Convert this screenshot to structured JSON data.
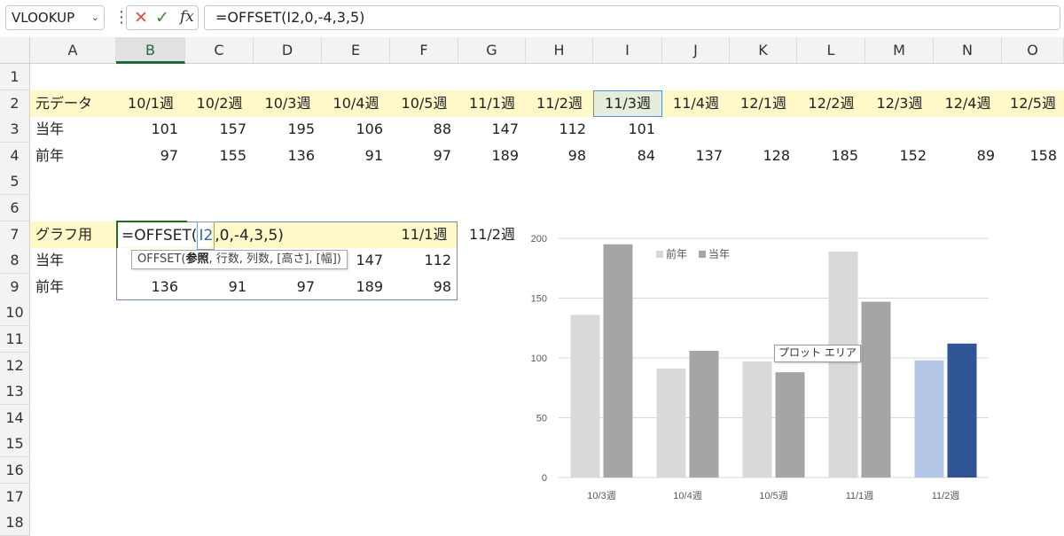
{
  "formula_bar": {
    "name_box": "VLOOKUP",
    "formula": "=OFFSET(I2,0,-4,3,5)"
  },
  "columns": [
    "A",
    "B",
    "C",
    "D",
    "E",
    "F",
    "G",
    "H",
    "I",
    "J",
    "K",
    "L",
    "M",
    "N",
    "O"
  ],
  "rows": [
    "1",
    "2",
    "3",
    "4",
    "5",
    "6",
    "7",
    "8",
    "9",
    "10",
    "11",
    "12",
    "13",
    "14",
    "15",
    "16",
    "17",
    "18"
  ],
  "sheet": {
    "row2": {
      "label": "元データ",
      "weeks": [
        "10/1週",
        "10/2週",
        "10/3週",
        "10/4週",
        "10/5週",
        "11/1週",
        "11/2週",
        "11/3週",
        "11/4週",
        "12/1週",
        "12/2週",
        "12/3週",
        "12/4週",
        "12/5週"
      ]
    },
    "row3": {
      "label": "当年",
      "values": [
        "101",
        "157",
        "195",
        "106",
        "88",
        "147",
        "112",
        "101"
      ]
    },
    "row4": {
      "label": "前年",
      "values": [
        "97",
        "155",
        "136",
        "91",
        "97",
        "189",
        "98",
        "84",
        "137",
        "128",
        "185",
        "152",
        "89",
        "158"
      ]
    },
    "row7": {
      "label": "グラフ用",
      "edit_prefix": "=OFFSET(",
      "edit_ref": "I2",
      "edit_suffix": ",0,-4,3,5)",
      "f": "11/1週",
      "g": "11/2週"
    },
    "row8": {
      "label": "当年",
      "f": "147",
      "g": "112"
    },
    "row9": {
      "label": "前年",
      "values": [
        "136",
        "91",
        "97",
        "189",
        "98"
      ]
    },
    "tooltip": {
      "fn": "OFFSET(",
      "arg1": "参照",
      "rest": ", 行数, 列数, [高さ], [幅])"
    }
  },
  "chart_data": {
    "type": "bar",
    "categories": [
      "10/3週",
      "10/4週",
      "10/5週",
      "11/1週",
      "11/2週"
    ],
    "series": [
      {
        "name": "前年",
        "values": [
          136,
          91,
          97,
          189,
          98
        ],
        "color": "#d9d9d9"
      },
      {
        "name": "当年",
        "values": [
          195,
          106,
          88,
          147,
          112
        ],
        "color": "#a5a5a5"
      }
    ],
    "highlight_colors": {
      "前年": "#b4c7e7",
      "当年": "#2f5597"
    },
    "highlight_index": 4,
    "yticks": [
      "0",
      "50",
      "100",
      "150",
      "200"
    ],
    "ylim": [
      0,
      200
    ],
    "grid": true,
    "legend": "top-left",
    "tooltip": "プロット エリア"
  }
}
